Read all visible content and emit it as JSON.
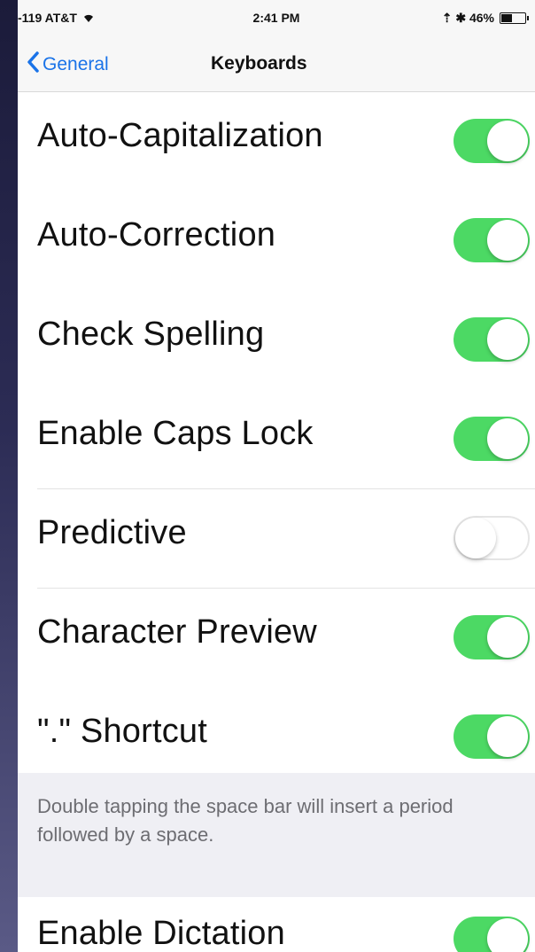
{
  "status_bar": {
    "carrier": "-119 AT&T",
    "time": "2:41 PM",
    "indicators": "⇡ ✱ 46%",
    "battery_level": 0.46
  },
  "nav": {
    "back_label": "General",
    "title": "Keyboards"
  },
  "settings": [
    {
      "label": "Auto-Capitalization",
      "on": true
    },
    {
      "label": "Auto-Correction",
      "on": true
    },
    {
      "label": "Check Spelling",
      "on": true
    },
    {
      "label": "Enable Caps Lock",
      "on": true
    },
    {
      "label": "Predictive",
      "on": false
    },
    {
      "label": "Character Preview",
      "on": true
    },
    {
      "label": "\".\" Shortcut",
      "on": true
    }
  ],
  "shortcut_footer": "Double tapping the space bar will insert a period followed by a space.",
  "dictation": {
    "label": "Enable Dictation",
    "on": true
  },
  "colors": {
    "toggle_on": "#4cd964",
    "link": "#1a73e8"
  }
}
